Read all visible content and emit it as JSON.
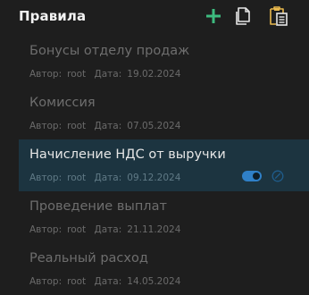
{
  "header": {
    "title": "Правила"
  },
  "toolbar": {
    "add_icon": "plus-icon",
    "copy_icon": "copy-icon",
    "paste_icon": "paste-icon",
    "accent_color": "#3dbb7f",
    "icon_color": "#e6e6e6",
    "paste_color": "#e8b84d"
  },
  "rules": [
    {
      "name": "Бонусы отделу продаж",
      "author_label": "Автор:",
      "author": "root",
      "date_label": "Дата:",
      "date": "19.02.2024",
      "selected": false
    },
    {
      "name": "Комиссия",
      "author_label": "Автор:",
      "author": "root",
      "date_label": "Дата:",
      "date": "07.05.2024",
      "selected": false
    },
    {
      "name": "Начисление НДС от выручки",
      "author_label": "Автор:",
      "author": "root",
      "date_label": "Дата:",
      "date": "09.12.2024",
      "selected": true,
      "enabled": true
    },
    {
      "name": "Проведение выплат",
      "author_label": "Автор:",
      "author": "root",
      "date_label": "Дата:",
      "date": "21.11.2024",
      "selected": false
    },
    {
      "name": "Реальный расход",
      "author_label": "Автор:",
      "author": "root",
      "date_label": "Дата:",
      "date": "14.05.2024",
      "selected": false
    }
  ],
  "colors": {
    "background": "#1e1e1e",
    "selected_row": "#1c3440",
    "toggle_on": "#2f80c8"
  }
}
